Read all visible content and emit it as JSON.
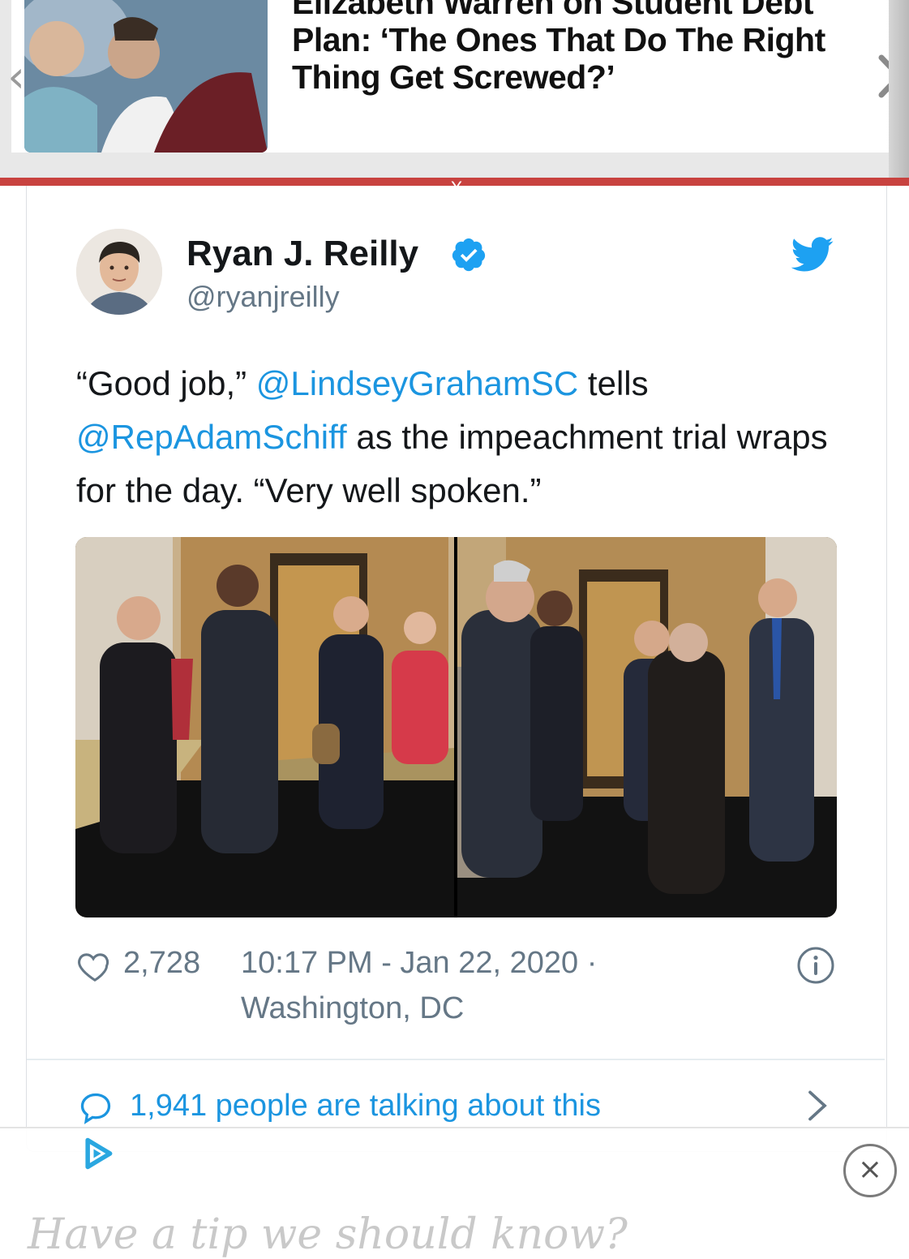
{
  "carousel": {
    "title": "Elizabeth Warren on Student Debt Plan: ‘The Ones That Do The Right Thing Get Screwed?’",
    "prev_icon": "chevron-left-icon",
    "next_icon": "chevron-right-icon",
    "close_label": "X"
  },
  "tweet": {
    "author_name": "Ryan J. Reilly",
    "author_handle": "@ryanjreilly",
    "verified_icon": "verified-badge-icon",
    "brand_icon": "twitter-bird-icon",
    "text_parts": {
      "p1": "“Good job,” ",
      "mention1": "@LindseyGrahamSC",
      "p2": " tells ",
      "mention2": "@RepAdamSchiff",
      "p3": " as the impeachment trial wraps for the day. “Very well spoken.”"
    },
    "like_count": "2,728",
    "timestamp": "10:17 PM - Jan 22, 2020 ·",
    "location": "Washington, DC",
    "talking_link": "1,941 people are talking about this",
    "colors": {
      "link": "#1b95e0",
      "muted": "#657786",
      "accent_red": "#c8423f"
    }
  },
  "ad": {
    "close_label": "×",
    "tip_text": "Have a tip we should know?"
  }
}
